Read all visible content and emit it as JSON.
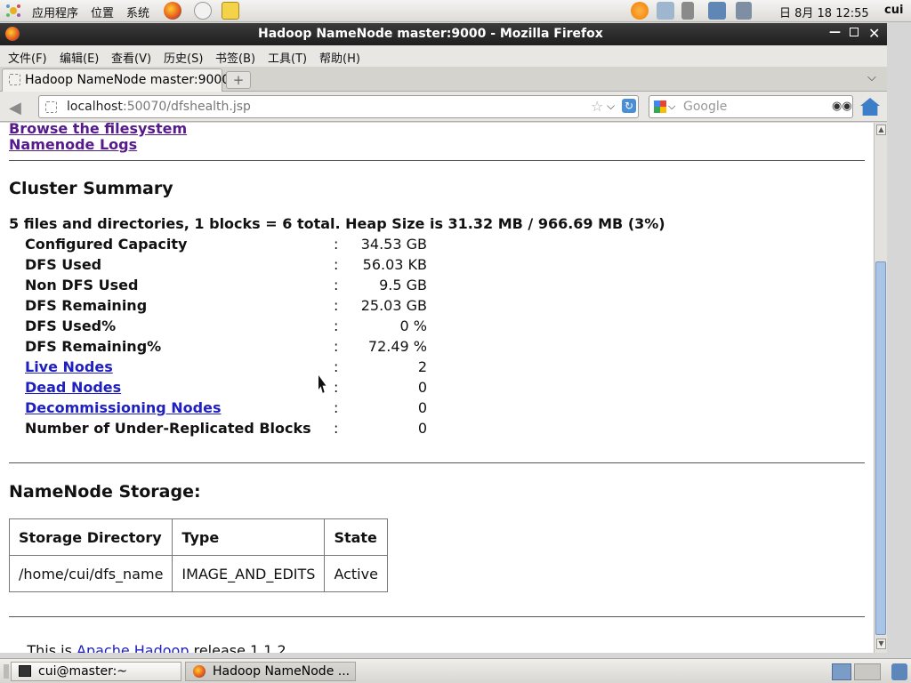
{
  "top_panel": {
    "apps_label": "应用程序",
    "places_label": "位置",
    "system_label": "系统",
    "clock": "日 8月 18 12:55",
    "user": "cui"
  },
  "window": {
    "title": "Hadoop NameNode master:9000 - Mozilla Firefox"
  },
  "menubar": {
    "items": [
      "文件(F)",
      "编辑(E)",
      "查看(V)",
      "历史(S)",
      "书签(B)",
      "工具(T)",
      "帮助(H)"
    ]
  },
  "tab": {
    "label": "Hadoop NameNode master:9000"
  },
  "navbar": {
    "url_host": "localhost",
    "url_rest": ":50070/dfshealth.jsp",
    "search_placeholder": "Google"
  },
  "page": {
    "link_browse": "Browse the filesystem",
    "link_logs": "Namenode Logs",
    "cluster_heading": "Cluster Summary",
    "summary_line": "5 files and directories, 1 blocks = 6 total. Heap Size is 31.32 MB / 966.69 MB (3%)",
    "rows": [
      {
        "label": "Configured Capacity",
        "value": "34.53 GB"
      },
      {
        "label": "DFS Used",
        "value": "56.03 KB"
      },
      {
        "label": "Non DFS Used",
        "value": "9.5 GB"
      },
      {
        "label": "DFS Remaining",
        "value": "25.03 GB"
      },
      {
        "label": "DFS Used%",
        "value": "0 %"
      },
      {
        "label": "DFS Remaining%",
        "value": "72.49 %"
      },
      {
        "label": "Live Nodes",
        "value": "2"
      },
      {
        "label": "Dead Nodes",
        "value": "0"
      },
      {
        "label": "Decommissioning Nodes",
        "value": "0"
      },
      {
        "label": "Number of Under-Replicated Blocks",
        "value": "0"
      }
    ],
    "colon": ":",
    "storage_heading": "NameNode Storage:",
    "storage_headers": [
      "Storage Directory",
      "Type",
      "State"
    ],
    "storage_row": [
      "/home/cui/dfs_name",
      "IMAGE_AND_EDITS",
      "Active"
    ],
    "footer_prefix": "This is ",
    "footer_link": "Apache Hadoop",
    "footer_suffix": " release 1.1.2"
  },
  "taskbar": {
    "terminal_label": "cui@master:~",
    "firefox_label": "Hadoop NameNode ..."
  },
  "colors": {
    "link": "#2020c0",
    "visited_link": "#551a8b",
    "titlebar": "#2b2b2b"
  }
}
